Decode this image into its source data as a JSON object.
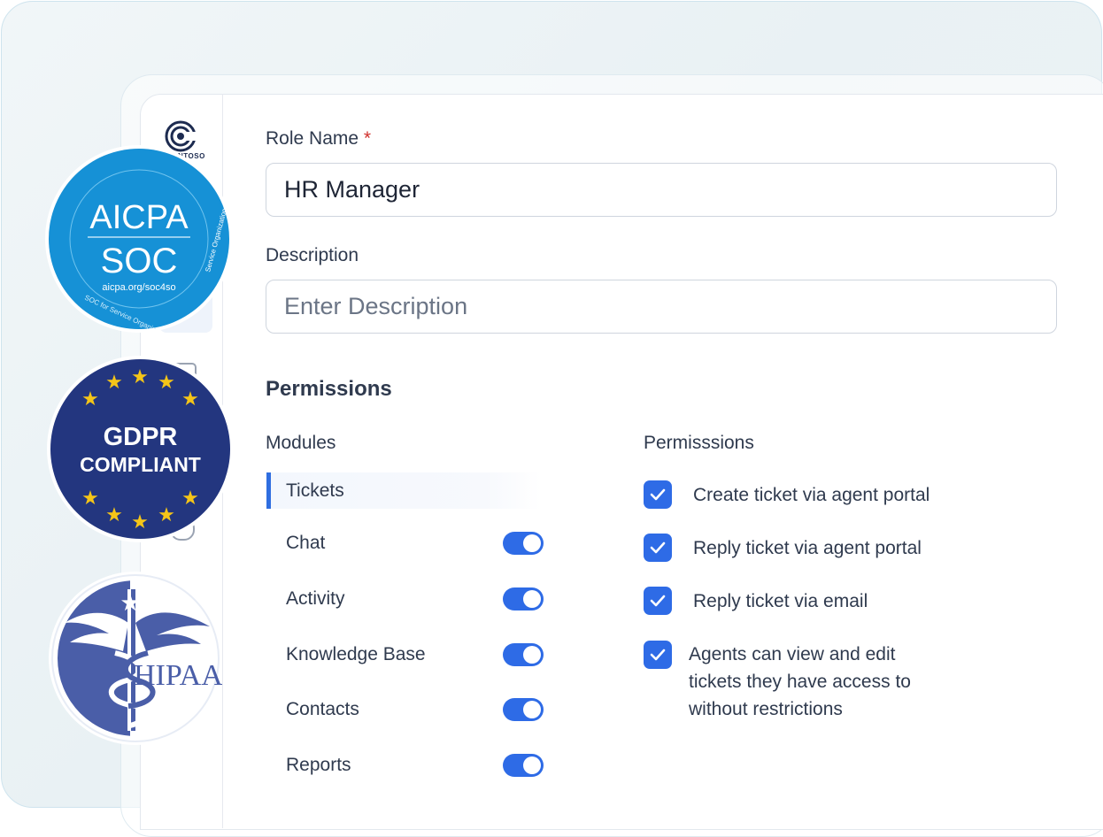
{
  "form": {
    "role_name_label": "Role Name",
    "required_marker": "*",
    "role_name_value": "HR Manager",
    "description_label": "Description",
    "description_placeholder": "Enter Description"
  },
  "permissions": {
    "heading": "Permissions",
    "modules_header": "Modules",
    "permissions_header": "Permisssions",
    "modules": [
      {
        "label": "Tickets",
        "active": true
      },
      {
        "label": "Chat",
        "enabled": true
      },
      {
        "label": "Activity",
        "enabled": true
      },
      {
        "label": "Knowledge Base",
        "enabled": true
      },
      {
        "label": "Contacts",
        "enabled": true
      },
      {
        "label": "Reports",
        "enabled": true
      }
    ],
    "items": [
      {
        "label": "Create ticket via agent portal",
        "checked": true
      },
      {
        "label": "Reply ticket via agent portal",
        "checked": true
      },
      {
        "label": "Reply ticket via email",
        "checked": true
      },
      {
        "label_lines": [
          "Agents can view and edit",
          "tickets they have access to",
          "without restrictions"
        ],
        "checked": true
      }
    ]
  },
  "brand": {
    "logo_text": "CONTOSO",
    "logo_icon": "contoso-logo-icon"
  },
  "badges": {
    "aicpa": {
      "title": "AICPA",
      "subtitle": "SOC",
      "url": "aicpa.org/soc4so",
      "ring_left": "SOC for Service Organizations",
      "ring_right": "Service Organizations"
    },
    "gdpr": {
      "line1": "GDPR",
      "line2": "COMPLIANT"
    },
    "hipaa": {
      "text": "HIPAA"
    }
  },
  "colors": {
    "accent": "#2e6be6",
    "text": "#2f3a4e",
    "required": "#d0312d",
    "aicpa": "#1691d6",
    "gdpr": "#23367f",
    "hipaa": "#4a5ea8",
    "star": "#f5c518"
  }
}
